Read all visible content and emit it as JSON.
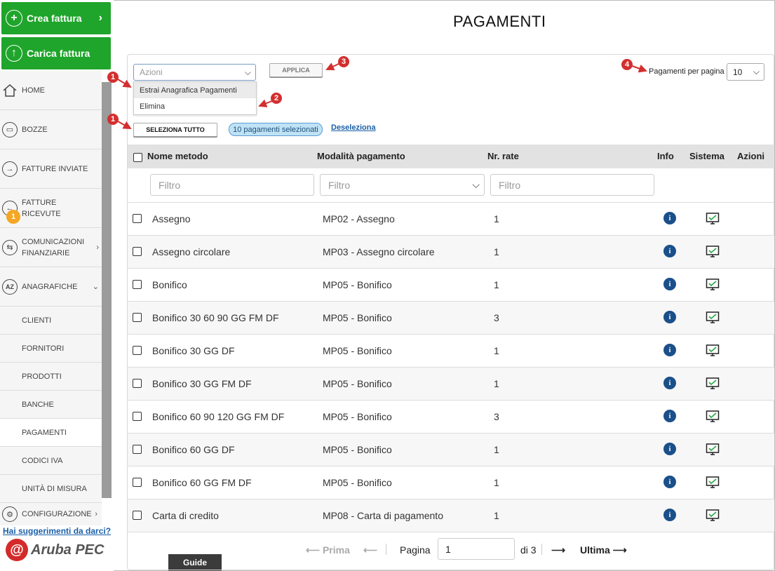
{
  "sidebar": {
    "create_invoice": "Crea fattura",
    "upload_invoice": "Carica fattura",
    "items": [
      {
        "label": "HOME"
      },
      {
        "label": "BOZZE"
      },
      {
        "label": "FATTURE INVIATE"
      },
      {
        "label": "FATTURE RICEVUTE",
        "badge": "1"
      },
      {
        "label": "COMUNICAZIONI FINANZIARIE"
      },
      {
        "label": "ANAGRAFICHE"
      },
      {
        "label": "CLIENTI"
      },
      {
        "label": "FORNITORI"
      },
      {
        "label": "PRODOTTI"
      },
      {
        "label": "BANCHE"
      },
      {
        "label": "PAGAMENTI"
      },
      {
        "label": "CODICI IVA"
      },
      {
        "label": "UNITÀ DI MISURA"
      },
      {
        "label": "CONFIGURAZIONE"
      }
    ],
    "suggestions_link": "Hai suggerimenti da darci?",
    "logo_text": "Aruba PEC",
    "guide": "Guide"
  },
  "page": {
    "title": "PAGAMENTI"
  },
  "toolbar": {
    "actions_placeholder": "Azioni",
    "actions_options": [
      "Estrai Anagrafica Pagamenti",
      "Elimina"
    ],
    "apply": "APPLICA",
    "select_all": "SELEZIONA TUTTO",
    "selected_count": "10 pagamenti selezionati",
    "deselect": "Deseleziona",
    "per_page_label": "Pagamenti per pagina",
    "per_page_value": "10"
  },
  "callouts": [
    "1",
    "2",
    "3",
    "4",
    "1"
  ],
  "table": {
    "headers": {
      "name": "Nome metodo",
      "mode": "Modalità pagamento",
      "rates": "Nr. rate",
      "info": "Info",
      "system": "Sistema",
      "actions": "Azioni"
    },
    "filters": {
      "name": "Filtro",
      "mode": "Filtro",
      "rates": "Filtro"
    },
    "rows": [
      {
        "name": "Assegno",
        "mode": "MP02 - Assegno",
        "rates": "1"
      },
      {
        "name": "Assegno circolare",
        "mode": "MP03 - Assegno circolare",
        "rates": "1"
      },
      {
        "name": "Bonifico",
        "mode": "MP05 - Bonifico",
        "rates": "1"
      },
      {
        "name": "Bonifico 30 60 90 GG FM DF",
        "mode": "MP05 - Bonifico",
        "rates": "3"
      },
      {
        "name": "Bonifico 30 GG DF",
        "mode": "MP05 - Bonifico",
        "rates": "1"
      },
      {
        "name": "Bonifico 30 GG FM DF",
        "mode": "MP05 - Bonifico",
        "rates": "1"
      },
      {
        "name": "Bonifico 60 90 120 GG FM DF",
        "mode": "MP05 - Bonifico",
        "rates": "3"
      },
      {
        "name": "Bonifico 60 GG DF",
        "mode": "MP05 - Bonifico",
        "rates": "1"
      },
      {
        "name": "Bonifico 60 GG FM DF",
        "mode": "MP05 - Bonifico",
        "rates": "1"
      },
      {
        "name": "Carta di credito",
        "mode": "MP08 - Carta di pagamento",
        "rates": "1"
      }
    ]
  },
  "pagination": {
    "first": "Prima",
    "page_label": "Pagina",
    "page_value": "1",
    "of": "di 3",
    "last": "Ultima"
  },
  "colors": {
    "green": "#1fa52b",
    "callout_red": "#d32f2f",
    "info_blue": "#1a4f8a",
    "link_blue": "#1a5fa8"
  }
}
